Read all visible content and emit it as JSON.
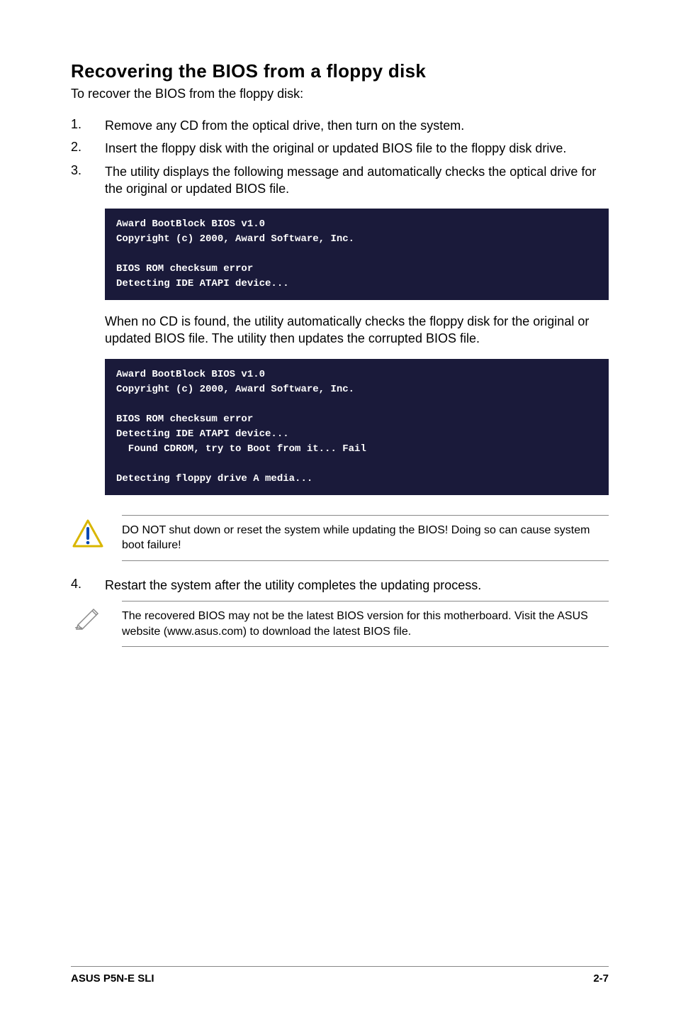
{
  "heading": "Recovering the BIOS from a floppy disk",
  "intro": "To recover the BIOS from the floppy disk:",
  "steps": {
    "s1_num": "1.",
    "s1_text": "Remove any CD from the optical drive, then turn on the system.",
    "s2_num": "2.",
    "s2_text": "Insert the floppy disk with the original or updated BIOS file to the floppy disk drive.",
    "s3_num": "3.",
    "s3_text": "The utility displays the following message and automatically checks the optical drive for the original or updated BIOS file.",
    "s4_num": "4.",
    "s4_text": "Restart the system after the utility completes the updating process."
  },
  "terminal1": "Award BootBlock BIOS v1.0\nCopyright (c) 2000, Award Software, Inc.\n\nBIOS ROM checksum error\nDetecting IDE ATAPI device...",
  "mid_para": "When no CD is found, the utility automatically checks the floppy disk for the original or updated BIOS file. The utility then updates the corrupted BIOS file.",
  "terminal2": "Award BootBlock BIOS v1.0\nCopyright (c) 2000, Award Software, Inc.\n\nBIOS ROM checksum error\nDetecting IDE ATAPI device...\n  Found CDROM, try to Boot from it... Fail\n\nDetecting floppy drive A media...",
  "warning_text": "DO NOT shut down or reset the system while updating the BIOS! Doing so can cause system boot failure!",
  "note_text": "The recovered BIOS may not be the latest BIOS version for this motherboard. Visit the ASUS website (www.asus.com) to download the latest BIOS file.",
  "footer_left": "ASUS P5N-E SLI",
  "footer_right": "2-7"
}
